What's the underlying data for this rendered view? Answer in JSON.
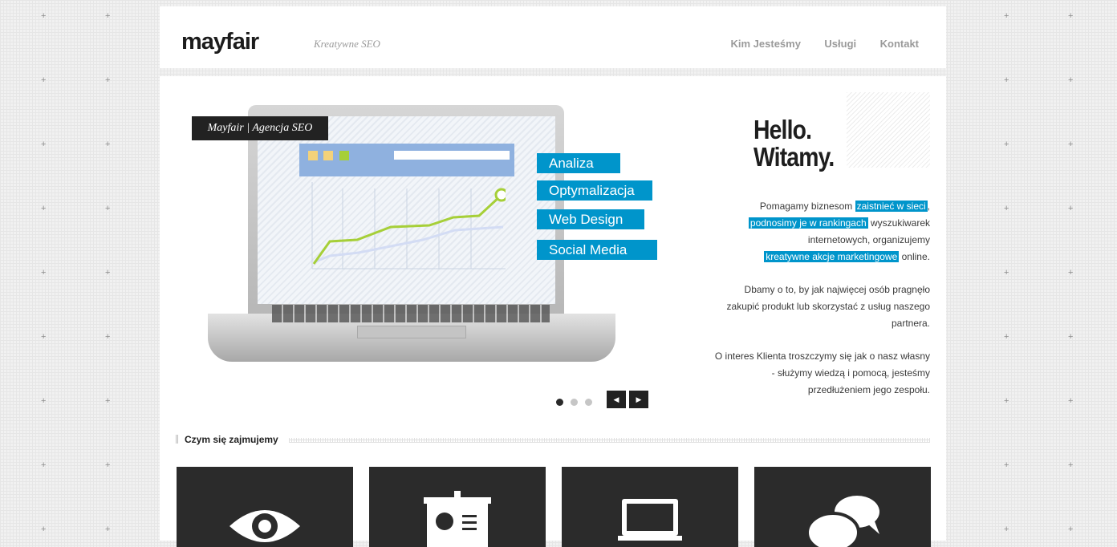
{
  "header": {
    "logo": "mayfair",
    "tagline": "Kreatywne SEO",
    "nav": [
      "Kim Jesteśmy",
      "Usługi",
      "Kontakt"
    ]
  },
  "hero": {
    "label": "Mayfair | Agencja SEO",
    "tags": [
      "Analiza",
      "Optymalizacja",
      "Web Design",
      "Social Media"
    ],
    "slider": {
      "slides": 3,
      "active": 1
    }
  },
  "intro": {
    "hello": [
      "Hello.",
      "Witamy."
    ],
    "p1": {
      "a": "Pomagamy biznesom ",
      "hl1": "zaistnieć w sieci",
      "b": ",",
      "hl2": "podnosimy je w rankingach",
      "c": " wyszukiwarek internetowych, organizujemy ",
      "hl3": "kreatywne akcje marketingowe",
      "d": " online."
    },
    "p2": "Dbamy o to, by jak najwięcej osób pragnęło zakupić produkt lub skorzystać z usług naszego partnera.",
    "p3": "O interes Klienta troszczymy się jak o nasz własny - służymy wiedzą i pomocą, jesteśmy przedłużeniem jego zespołu."
  },
  "services": {
    "title": "Czym się zajmujemy",
    "icons": [
      "eye-icon",
      "presentation-board-icon",
      "laptop-icon",
      "chat-bubbles-icon"
    ]
  },
  "colors": {
    "accent": "#0095cb",
    "dark": "#2b2b2b",
    "lime": "#a6cf38"
  }
}
